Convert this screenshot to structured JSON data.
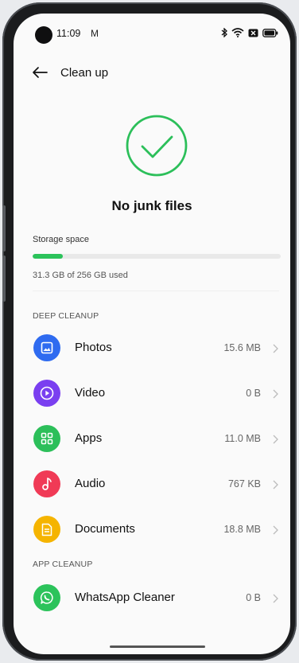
{
  "status_bar": {
    "time": "11:09",
    "mail_icon_text": "M",
    "icons": [
      "camera-icon",
      "gmail-icon",
      "bluetooth-icon",
      "wifi-icon",
      "screen-record-icon",
      "battery-icon"
    ]
  },
  "header": {
    "back_icon": "arrow-left-icon",
    "title": "Clean up"
  },
  "result": {
    "icon": "check-circle-icon",
    "heading": "No junk files"
  },
  "storage": {
    "label": "Storage space",
    "used_text": "31.3 GB of 256 GB used",
    "used_fraction": 0.122
  },
  "deep_cleanup": {
    "header": "DEEP CLEANUP",
    "items": [
      {
        "label": "Photos",
        "size": "15.6 MB",
        "icon": "photo-icon",
        "color": "#2f6bf0"
      },
      {
        "label": "Video",
        "size": "0 B",
        "icon": "play-icon",
        "color": "#7a3ff0"
      },
      {
        "label": "Apps",
        "size": "11.0 MB",
        "icon": "apps-grid-icon",
        "color": "#2cbf5a"
      },
      {
        "label": "Audio",
        "size": "767 KB",
        "icon": "music-note-icon",
        "color": "#f03a56"
      },
      {
        "label": "Documents",
        "size": "18.8 MB",
        "icon": "document-icon",
        "color": "#f5b400"
      }
    ]
  },
  "app_cleanup": {
    "header": "APP CLEANUP",
    "items": [
      {
        "label": "WhatsApp Cleaner",
        "size": "0 B",
        "icon": "whatsapp-icon",
        "color": "#2cc35b"
      }
    ]
  },
  "colors": {
    "accent_green": "#2cc35b",
    "check_green": "#2cbf5a"
  }
}
